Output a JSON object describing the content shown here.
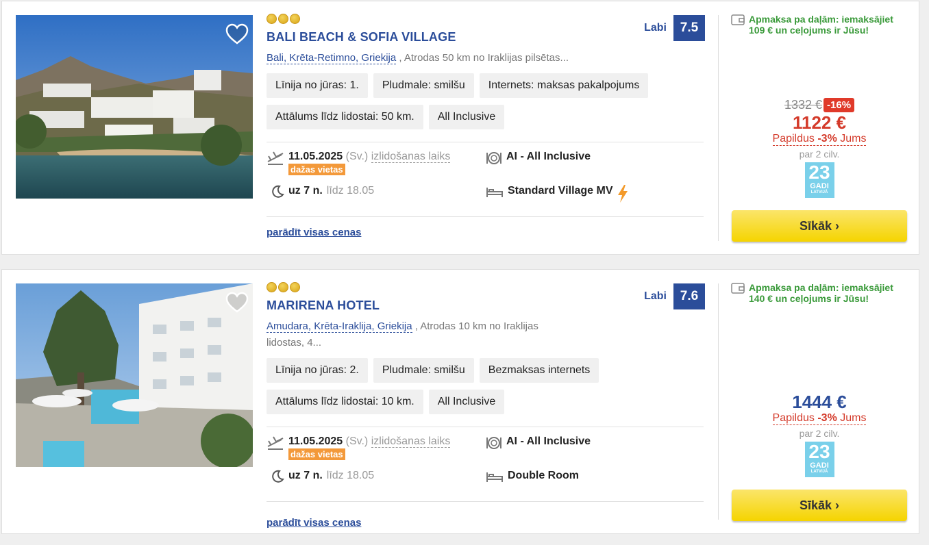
{
  "colors": {
    "brand_blue": "#2b4d9a",
    "discount_red": "#e03a2a",
    "badge_orange": "#f3993a",
    "button_yellow": "#f5d400",
    "pay_green": "#3a9a3a"
  },
  "hotels": [
    {
      "stars": 3,
      "name": "BALI BEACH & SOFIA VILLAGE",
      "rating_word": "Labi",
      "rating_score": "7.5",
      "location_link": "Bali, Krēta-Retimno, Griekija",
      "location_rest": " , Atrodas 50 km no Iraklijas pilsētas...",
      "tags_row1": [
        "Līnija no jūras: 1.",
        "Pludmale: smilšu",
        "Internets: maksas pakalpojums"
      ],
      "tags_row2": [
        "Attālums līdz lidostai: 50 km.",
        "All Inclusive"
      ],
      "departure_date": "11.05.2025",
      "departure_day": "(Sv.)",
      "departure_time_label": "izlidošanas laiks",
      "seats_badge": "dažas vietas",
      "duration": "uz 7 n.",
      "until": "līdz 18.05",
      "board": "AI - All Inclusive",
      "room": "Standard Village MV",
      "room_flash_icon": "lightning-icon",
      "show_all": "parādīt visas cenas",
      "pay_text": "Apmaksa pa daļām: iemaksājiet 109 € un ceļojums ir Jūsu!",
      "old_price": "1332 €",
      "discount": "-16%",
      "price": "1122 €",
      "price_color": "#d43a2a",
      "extra_prefix": "Papildus ",
      "extra_pct": "-3%",
      "extra_suffix": " Jums",
      "per_people": "par 2 cilv.",
      "logo_number": "23",
      "logo_word": "GADI",
      "logo_country": "LATVIJĀ",
      "button": "Sīkāk ›"
    },
    {
      "stars": 3,
      "name": "MARIRENA HOTEL",
      "rating_word": "Labi",
      "rating_score": "7.6",
      "location_link": "Amudara, Krēta-Iraklija, Griekija",
      "location_rest": " , Atrodas 10 km no Iraklijas lidostas, 4...",
      "tags_row1": [
        "Līnija no jūras: 2.",
        "Pludmale: smilšu",
        "Bezmaksas internets"
      ],
      "tags_row2": [
        "Attālums līdz lidostai: 10 km.",
        "All Inclusive"
      ],
      "departure_date": "11.05.2025",
      "departure_day": "(Sv.)",
      "departure_time_label": "izlidošanas laiks",
      "seats_badge": "dažas vietas",
      "duration": "uz 7 n.",
      "until": "līdz 18.05",
      "board": "AI - All Inclusive",
      "room": "Double Room",
      "show_all": "parādīt visas cenas",
      "pay_text": "Apmaksa pa daļām: iemaksājiet 140 € un ceļojums ir Jūsu!",
      "price": "1444 €",
      "price_color": "#2b4d9a",
      "extra_prefix": "Papildus ",
      "extra_pct": "-3%",
      "extra_suffix": " Jums",
      "per_people": "par 2 cilv.",
      "logo_number": "23",
      "logo_word": "GADI",
      "logo_country": "LATVIJĀ",
      "button": "Sīkāk ›"
    }
  ]
}
